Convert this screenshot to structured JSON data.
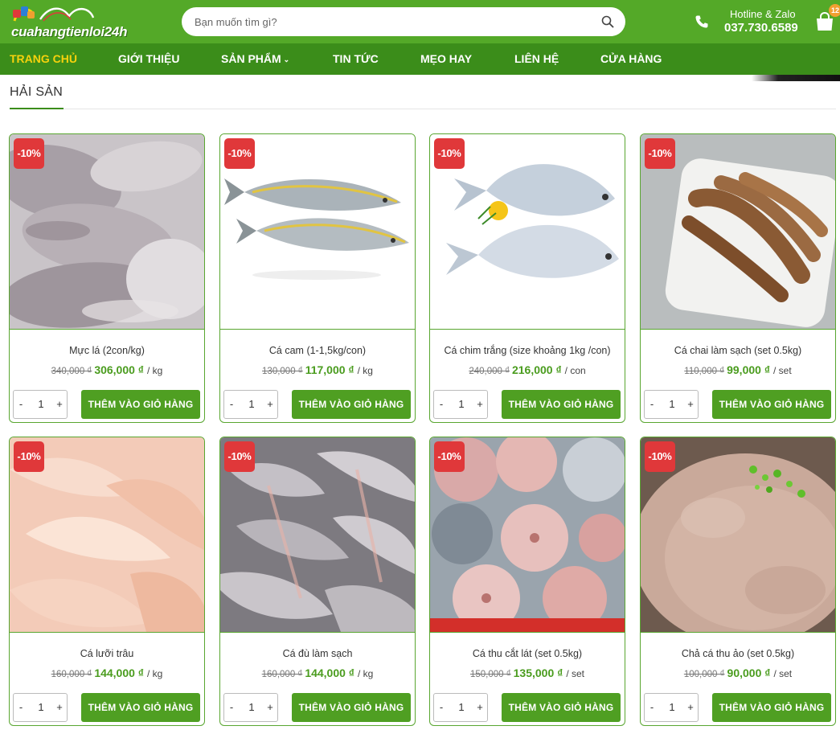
{
  "header": {
    "logo_text": "cuahangtienloi24h",
    "search": {
      "placeholder": "Bạn muốn tìm gì?"
    },
    "hotline_label": "Hotline & Zalo",
    "hotline_number": "037.730.6589",
    "cart_count": "12",
    "icons": {
      "search": "search-icon",
      "phone": "phone-icon",
      "cart": "shopping-bag-icon"
    },
    "colors": {
      "header_green": "#54a928",
      "nav_green": "#3b8d1a",
      "active": "#f7d20c"
    }
  },
  "nav": {
    "items": [
      {
        "label": "TRANG CHỦ",
        "active": true
      },
      {
        "label": "GIỚI THIỆU"
      },
      {
        "label": "SẢN PHẨM",
        "has_dropdown": true
      },
      {
        "label": "TIN TỨC"
      },
      {
        "label": "MẸO HAY"
      },
      {
        "label": "LIÊN HỆ"
      },
      {
        "label": "CỬA HÀNG"
      }
    ]
  },
  "section": {
    "title": "HẢI SẢN"
  },
  "product_common": {
    "add_label": "THÊM VÀO GIỎ HÀNG",
    "minus": "-",
    "plus": "+",
    "qty": "1",
    "discount_color": "#e0383a",
    "price_color": "#4a9c1e"
  },
  "products": [
    {
      "badge": "-10%",
      "name": "Mực lá (2con/kg)",
      "old_price": "340,000 ₫",
      "price": "306,000 ₫",
      "unit": "/ kg",
      "image": "squid"
    },
    {
      "badge": "-10%",
      "name": "Cá cam (1-1,5kg/con)",
      "old_price": "130,000 ₫",
      "price": "117,000 ₫",
      "unit": "/ kg",
      "image": "amberjack"
    },
    {
      "badge": "-10%",
      "name": "Cá chim trắng (size khoảng 1kg /con)",
      "old_price": "240,000 ₫",
      "price": "216,000 ₫",
      "unit": "/ con",
      "image": "pomfret"
    },
    {
      "badge": "-10%",
      "name": "Cá chai làm sạch (set 0.5kg)",
      "old_price": "110,000 ₫",
      "price": "99,000 ₫",
      "unit": "/ set",
      "image": "flathead-tray"
    },
    {
      "badge": "-10%",
      "name": "Cá lưỡi trâu",
      "old_price": "160,000 ₫",
      "price": "144,000 ₫",
      "unit": "/ kg",
      "image": "sole-fillets"
    },
    {
      "badge": "-10%",
      "name": "Cá đù làm sạch",
      "old_price": "160,000 ₫",
      "price": "144,000 ₫",
      "unit": "/ kg",
      "image": "croaker"
    },
    {
      "badge": "-10%",
      "name": "Cá thu cắt lát (set 0.5kg)",
      "old_price": "150,000 ₫",
      "price": "135,000 ₫",
      "unit": "/ set",
      "image": "mackerel-steaks"
    },
    {
      "badge": "-10%",
      "name": "Chả cá thu ảo (set 0.5kg)",
      "old_price": "100,000 ₫",
      "price": "90,000 ₫",
      "unit": "/ set",
      "image": "fish-cake"
    }
  ]
}
